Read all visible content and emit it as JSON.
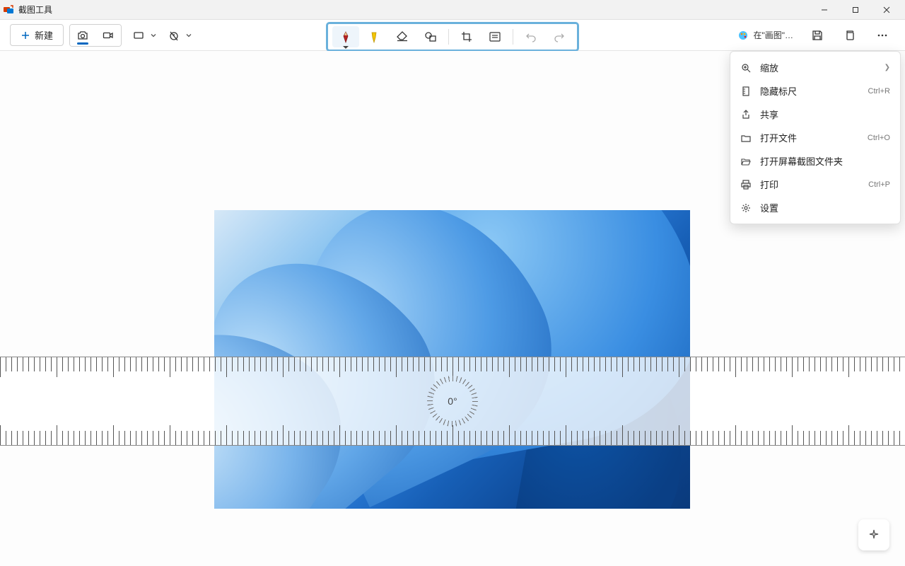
{
  "titlebar": {
    "app_name": "截图工具"
  },
  "toolbar": {
    "new_label": "新建",
    "paint_link_label": "在\"画图\"…"
  },
  "ruler": {
    "angle_label": "0°"
  },
  "menu": {
    "items": [
      {
        "icon": "zoom",
        "label": "缩放",
        "shortcut": "",
        "arrow": true
      },
      {
        "icon": "ruler",
        "label": "隐藏标尺",
        "shortcut": "Ctrl+R",
        "arrow": false
      },
      {
        "icon": "share",
        "label": "共享",
        "shortcut": "",
        "arrow": false
      },
      {
        "icon": "folder",
        "label": "打开文件",
        "shortcut": "Ctrl+O",
        "arrow": false
      },
      {
        "icon": "folder-open",
        "label": "打开屏幕截图文件夹",
        "shortcut": "",
        "arrow": false
      },
      {
        "icon": "print",
        "label": "打印",
        "shortcut": "Ctrl+P",
        "arrow": false
      },
      {
        "icon": "gear",
        "label": "设置",
        "shortcut": "",
        "arrow": false
      }
    ]
  }
}
